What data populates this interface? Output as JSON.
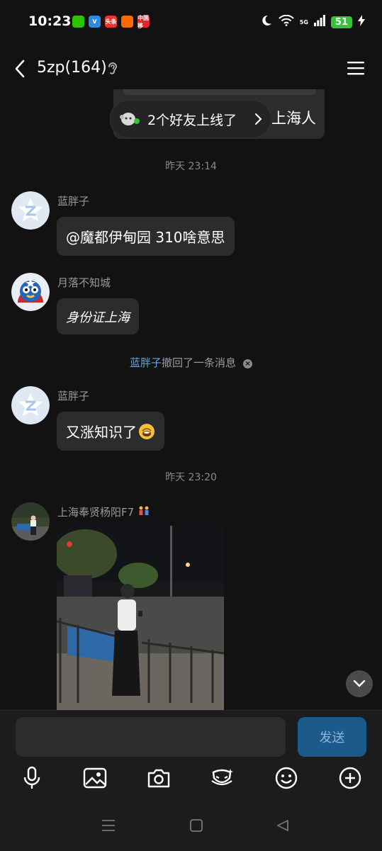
{
  "status_bar": {
    "time": "10:23",
    "app_icons": [
      {
        "name": "wechat-icon",
        "color": "#2dc100",
        "text": ""
      },
      {
        "name": "vpn-icon",
        "color": "#2c8ae0",
        "text": "V"
      },
      {
        "name": "toutiao-icon",
        "color": "#e8352e",
        "text": "头条"
      },
      {
        "name": "taobao-icon",
        "color": "#ff6a00",
        "text": ""
      },
      {
        "name": "jd-icon",
        "color": "#e0242a",
        "text": "中国移"
      }
    ],
    "network": "5G",
    "battery": "51"
  },
  "header": {
    "title": "5zp(164)"
  },
  "online_banner": {
    "text": "2个好友上线了"
  },
  "previous_message": {
    "text": "上海人"
  },
  "messages": {
    "ts1": "昨天 23:14",
    "m1": {
      "sender": "蓝胖子",
      "text": "@魔都伊甸园 310啥意思"
    },
    "m2": {
      "sender": "月落不知城",
      "text": "身份证上海"
    },
    "recall": {
      "name": "蓝胖子",
      "text": "撤回了一条消息"
    },
    "m3": {
      "sender": "蓝胖子",
      "text": "又涨知识了"
    },
    "ts2": "昨天 23:20",
    "m4": {
      "sender": "上海奉贤杨阳F7"
    }
  },
  "input": {
    "placeholder": "",
    "send_label": "发送"
  },
  "colors": {
    "accent": "#1d5a8c",
    "recall_name": "#6d9ee8",
    "bubble": "#2c2c2e"
  }
}
